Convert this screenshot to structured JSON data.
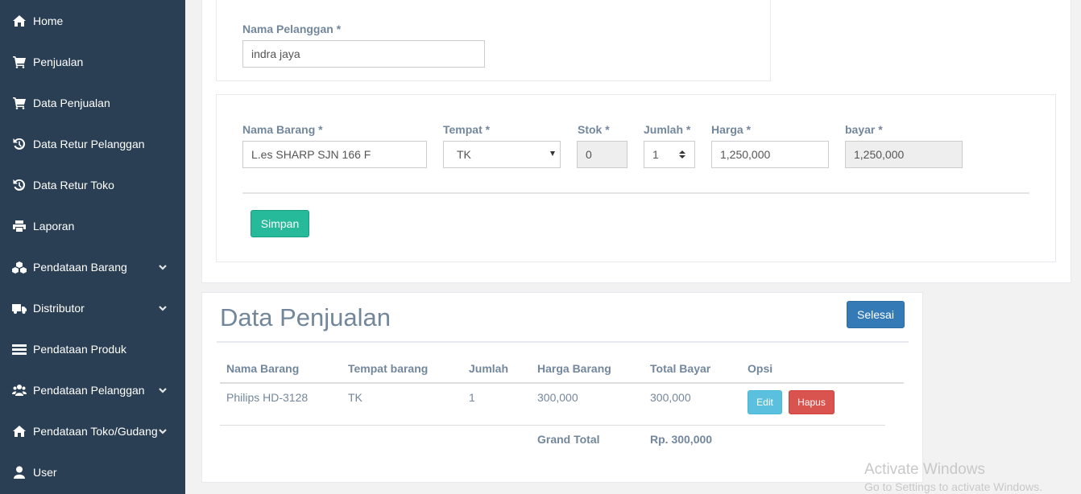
{
  "sidebar": {
    "items": [
      {
        "label": "Home",
        "icon": "home-icon",
        "has_submenu": false
      },
      {
        "label": "Penjualan",
        "icon": "cart-icon",
        "has_submenu": false
      },
      {
        "label": "Data Penjualan",
        "icon": "cart-icon",
        "has_submenu": false
      },
      {
        "label": "Data Retur Pelanggan",
        "icon": "history-icon",
        "has_submenu": false
      },
      {
        "label": "Data Retur Toko",
        "icon": "history-icon",
        "has_submenu": false
      },
      {
        "label": "Laporan",
        "icon": "print-icon",
        "has_submenu": false
      },
      {
        "label": "Pendataan Barang",
        "icon": "cubes-icon",
        "has_submenu": true
      },
      {
        "label": "Distributor",
        "icon": "truck-icon",
        "has_submenu": true
      },
      {
        "label": "Pendataan Produk",
        "icon": "list-icon",
        "has_submenu": false
      },
      {
        "label": "Pendataan Pelanggan",
        "icon": "users-icon",
        "has_submenu": true
      },
      {
        "label": "Pendataan Toko/Gudang",
        "icon": "home-icon",
        "has_submenu": true
      },
      {
        "label": "User",
        "icon": "user-icon",
        "has_submenu": false
      }
    ]
  },
  "customer_form": {
    "name_label": "Nama Pelanggan *",
    "name_value": "indra jaya"
  },
  "item_form": {
    "nama_barang_label": "Nama Barang *",
    "nama_barang_value": "L.es SHARP SJN 166 F",
    "tempat_label": "Tempat *",
    "tempat_value": "TK",
    "stok_label": "Stok *",
    "stok_value": "0",
    "jumlah_label": "Jumlah *",
    "jumlah_value": "1",
    "harga_label": "Harga *",
    "harga_value": "1,250,000",
    "bayar_label": "bayar *",
    "bayar_value": "1,250,000",
    "save_label": "Simpan"
  },
  "sales": {
    "title": "Data Penjualan",
    "finish_label": "Selesai",
    "columns": [
      "Nama Barang",
      "Tempat barang",
      "Jumlah",
      "Harga Barang",
      "Total Bayar",
      "Opsi"
    ],
    "rows": [
      {
        "nama": "Philips HD-3128",
        "tempat": "TK",
        "jumlah": "1",
        "harga": "300,000",
        "total": "300,000",
        "edit_label": "Edit",
        "delete_label": "Hapus"
      }
    ],
    "grand_total_label": "Grand Total",
    "grand_total_value": "Rp. 300,000"
  },
  "watermark": {
    "line1": "Activate Windows",
    "line2": "Go to Settings to activate Windows."
  },
  "colors": {
    "sidebar_bg": "#2a3f54",
    "success": "#26b99a",
    "primary": "#337ab7",
    "info": "#5bc0de",
    "danger": "#d9534f"
  }
}
